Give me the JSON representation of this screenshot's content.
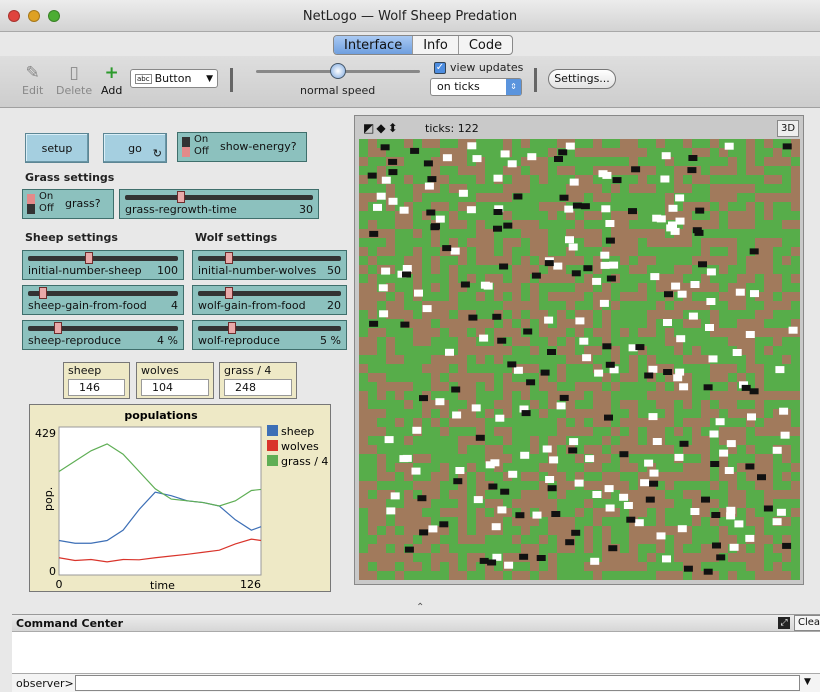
{
  "window": {
    "title": "NetLogo — Wolf Sheep Predation"
  },
  "tabs": [
    {
      "label": "Interface"
    },
    {
      "label": "Info"
    },
    {
      "label": "Code"
    }
  ],
  "toolbar": {
    "edit": "Edit",
    "delete": "Delete",
    "add": "Add",
    "widget_type": "Button",
    "speed_label": "normal speed",
    "speed_fraction": 0.5,
    "view_updates": "view updates",
    "update_mode": "on ticks",
    "settings": "Settings..."
  },
  "buttons": {
    "setup": "setup",
    "go": "go"
  },
  "switches": {
    "show_energy": {
      "label": "show-energy?",
      "on": "On",
      "off": "Off"
    },
    "grass": {
      "label": "grass?",
      "on": "On",
      "off": "Off"
    }
  },
  "sections": {
    "grass": "Grass settings",
    "sheep": "Sheep settings",
    "wolf": "Wolf settings"
  },
  "sliders": {
    "grass_regrowth": {
      "label": "grass-regrowth-time",
      "value": "30",
      "fraction": 0.29
    },
    "initial_sheep": {
      "label": "initial-number-sheep",
      "value": "100",
      "fraction": 0.4
    },
    "initial_wolves": {
      "label": "initial-number-wolves",
      "value": "50",
      "fraction": 0.2
    },
    "sheep_gain": {
      "label": "sheep-gain-from-food",
      "value": "4",
      "fraction": 0.08
    },
    "wolf_gain": {
      "label": "wolf-gain-from-food",
      "value": "20",
      "fraction": 0.2
    },
    "sheep_reproduce": {
      "label": "sheep-reproduce",
      "value": "4 %",
      "fraction": 0.18
    },
    "wolf_reproduce": {
      "label": "wolf-reproduce",
      "value": "5 %",
      "fraction": 0.22
    }
  },
  "monitors": [
    {
      "title": "sheep",
      "value": "146"
    },
    {
      "title": "wolves",
      "value": "104"
    },
    {
      "title": "grass / 4",
      "value": "248"
    }
  ],
  "view": {
    "ticks": "ticks: 122",
    "threed": "3D"
  },
  "command_center": {
    "title": "Command Center",
    "clear": "Clear",
    "prompt": "observer>"
  },
  "colors": {
    "sheep": "#3d6fb6",
    "wolves": "#d9342b",
    "grass": "#5fae55",
    "patch_green": "#57ad4a",
    "patch_brown": "#a17a5c"
  },
  "chart_data": {
    "type": "line",
    "title": "populations",
    "xlabel": "time",
    "ylabel": "pop.",
    "xlim": [
      0,
      126
    ],
    "ylim": [
      0,
      429
    ],
    "legend": "right",
    "series": [
      {
        "name": "sheep",
        "color": "#3d6fb6",
        "x": [
          0,
          10,
          20,
          30,
          40,
          50,
          60,
          70,
          80,
          90,
          100,
          110,
          120,
          126
        ],
        "values": [
          100,
          92,
          92,
          100,
          130,
          190,
          240,
          230,
          215,
          210,
          200,
          160,
          130,
          140
        ]
      },
      {
        "name": "wolves",
        "color": "#d9342b",
        "x": [
          0,
          10,
          20,
          30,
          40,
          50,
          60,
          70,
          80,
          90,
          100,
          110,
          120,
          126
        ],
        "values": [
          50,
          42,
          45,
          38,
          45,
          44,
          50,
          55,
          60,
          66,
          72,
          90,
          104,
          100
        ]
      },
      {
        "name": "grass / 4",
        "color": "#5fae55",
        "x": [
          0,
          10,
          20,
          30,
          40,
          50,
          60,
          70,
          80,
          90,
          100,
          110,
          120,
          126
        ],
        "values": [
          300,
          330,
          360,
          380,
          350,
          300,
          250,
          220,
          215,
          210,
          200,
          215,
          245,
          248
        ]
      }
    ]
  }
}
